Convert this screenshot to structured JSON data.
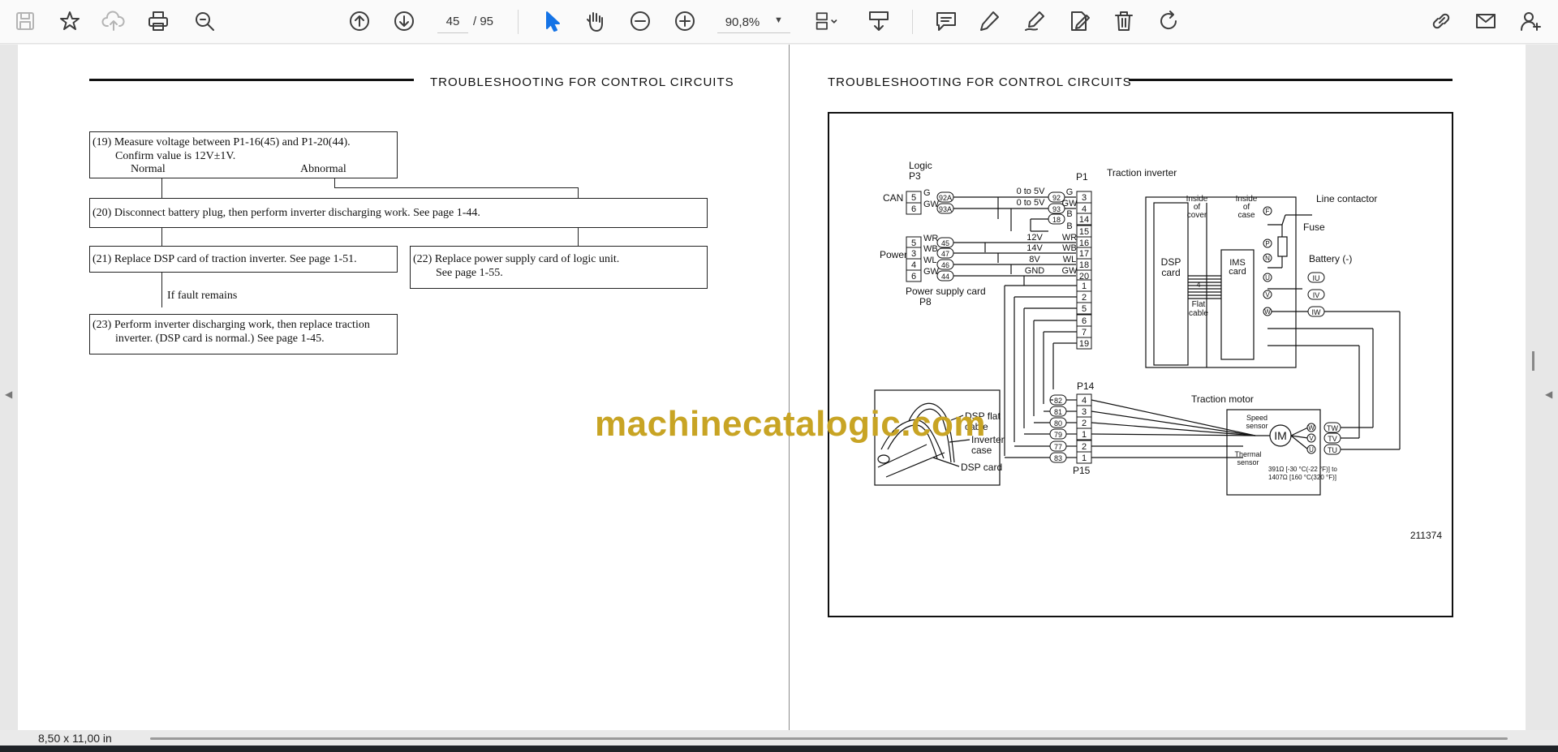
{
  "toolbar": {
    "left_icons": [
      "save-icon",
      "bookmark-star-icon",
      "cloud-upload-icon",
      "print-icon",
      "find-text-icon"
    ],
    "nav_icons": [
      "previous-page-icon",
      "next-page-icon"
    ],
    "current_page": "45",
    "page_total": "/ 95",
    "tool_icons": [
      "select-cursor-icon",
      "hand-pan-icon",
      "zoom-out-icon",
      "zoom-in-icon"
    ],
    "zoom_value": "90,8%",
    "view_icons": [
      "page-layout-icon",
      "read-mode-icon"
    ],
    "annotate_icons": [
      "comment-icon",
      "highlight-pen-icon",
      "draw-icon",
      "fill-sign-icon",
      "delete-icon",
      "rotate-icon"
    ],
    "right_icons": [
      "share-link-icon",
      "email-icon",
      "add-user-icon"
    ]
  },
  "left_page": {
    "header": "TROUBLESHOOTING  FOR  CONTROL  CIRCUITS",
    "step19": {
      "line1": "(19) Measure voltage between P1-16(45) and P1-20(44).",
      "line2": "Confirm value is 12V±1V."
    },
    "normal_label": "Normal",
    "abnormal_label": "Abnormal",
    "step20": "(20) Disconnect battery plug, then perform inverter discharging work. See page 1-44.",
    "step21": "(21) Replace DSP card of traction inverter. See page 1-51.",
    "step22": {
      "line1": "(22) Replace power supply card of logic unit.",
      "line2": "See page 1-55."
    },
    "fault_remains": "If fault remains",
    "step23": {
      "line1": "(23) Perform inverter discharging work, then replace traction",
      "line2": "inverter. (DSP card is normal.) See page 1-45."
    }
  },
  "right_page": {
    "header": "TROUBLESHOOTING  FOR  CONTROL  CIRCUITS",
    "diagram": {
      "logic_label": "Logic",
      "p3_label": "P3",
      "can_label": "CAN",
      "power_label": "Power",
      "power_supply_card": "Power supply card",
      "p8_label": "P8",
      "p1_label": "P1",
      "traction_inverter": "Traction inverter",
      "inside_of_cover": [
        "Inside",
        "of",
        "cover"
      ],
      "inside_of_case": [
        "Inside",
        "of",
        "case"
      ],
      "line_contactor": "Line contactor",
      "fuse": "Fuse",
      "battery": "Battery (-)",
      "dsp_card": [
        "DSP",
        "card"
      ],
      "ims_card": [
        "IMS",
        "card"
      ],
      "flat_cable": [
        "Flat",
        "cable"
      ],
      "flat_cable_count": "4",
      "p3_rows": [
        {
          "pin": "5",
          "wire": "G",
          "tag": "92A",
          "signal": "0 to 5V",
          "p1_tag": "92",
          "p1_wire": "G",
          "p1_pin": "3"
        },
        {
          "pin": "6",
          "wire": "GW",
          "tag": "93A",
          "signal": "0 to 5V",
          "p1_tag": "93",
          "p1_wire": "GW",
          "p1_pin": "4"
        }
      ],
      "extra_rows": [
        {
          "p1_tag": "18",
          "p1_wire": "B",
          "p1_pin": "14"
        },
        {
          "p1_tag": "",
          "p1_wire": "B",
          "p1_pin": "15"
        }
      ],
      "p8_rows": [
        {
          "pin": "5",
          "wire": "WR",
          "tag": "45",
          "signal": "12V",
          "p1_wire": "WR",
          "p1_pin": "16"
        },
        {
          "pin": "3",
          "wire": "WB",
          "tag": "47",
          "signal": "14V",
          "p1_wire": "WB",
          "p1_pin": "17"
        },
        {
          "pin": "4",
          "wire": "WL",
          "tag": "46",
          "signal": "8V",
          "p1_wire": "WL",
          "p1_pin": "18"
        },
        {
          "pin": "6",
          "wire": "GW",
          "tag": "44",
          "signal": "GND",
          "p1_wire": "GW",
          "p1_pin": "20"
        }
      ],
      "p1_lower_pins": [
        "1",
        "2",
        "5",
        "6",
        "7",
        "19"
      ],
      "terminals": [
        "F",
        "P",
        "N",
        "U",
        "V",
        "W"
      ],
      "phase_tags": [
        "IU",
        "IV",
        "IW"
      ],
      "p14_label": "P14",
      "p15_label": "P15",
      "traction_motor": "Traction motor",
      "speed_sensor": [
        "Speed",
        "sensor"
      ],
      "motor_symbol": "IM",
      "thermal_sensor": [
        "Thermal",
        "sensor"
      ],
      "thermal_spec": [
        "391Ω [-30 °C(-22 °F)] to",
        "1407Ω [160 °C(320 °F)]"
      ],
      "motor_terminals": [
        "W",
        "V",
        "U"
      ],
      "motor_tags": [
        "TW",
        "TV",
        "TU"
      ],
      "p14_rows": [
        {
          "tag": "82",
          "pin": "4"
        },
        {
          "tag": "81",
          "pin": "3"
        },
        {
          "tag": "80",
          "pin": "2"
        },
        {
          "tag": "79",
          "pin": "1"
        }
      ],
      "p15_rows": [
        {
          "tag": "77",
          "pin": "2"
        },
        {
          "tag": "83",
          "pin": "1"
        }
      ],
      "inset": {
        "dsp_flat_cable": [
          "DSP flat",
          "cable"
        ],
        "inverter_case": [
          "Inverter",
          "case"
        ],
        "dsp_card": "DSP card"
      },
      "figure_number": "211374"
    }
  },
  "watermark": "machinecatalogic.com",
  "status": {
    "page_size": "8,50 x 11,00 in"
  },
  "colors": {
    "accent": "#1473e6",
    "watermark": "#c8a424"
  }
}
